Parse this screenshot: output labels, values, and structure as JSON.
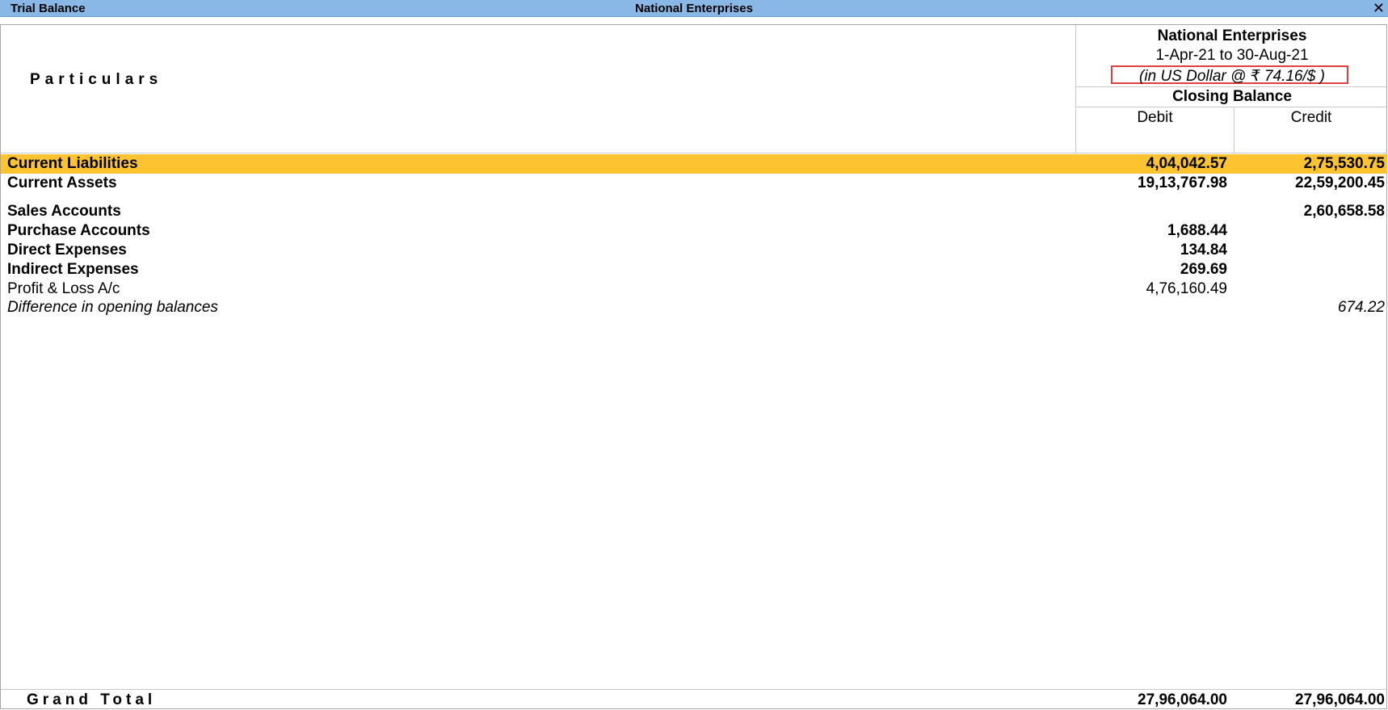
{
  "window": {
    "title": "Trial Balance",
    "company": "National Enterprises",
    "close_glyph": "✕"
  },
  "header": {
    "particulars_label": "Particulars",
    "company": "National Enterprises",
    "period": "1-Apr-21 to 30-Aug-21",
    "currency_note": "(in US Dollar  @ ₹ 74.16/$ )",
    "closing_balance_label": "Closing Balance",
    "debit_label": "Debit",
    "credit_label": "Credit"
  },
  "rows": [
    {
      "name": "Current Liabilities",
      "debit": "4,04,042.57",
      "credit": "2,75,530.75"
    },
    {
      "name": "Current Assets",
      "debit": "19,13,767.98",
      "credit": "22,59,200.45"
    },
    {
      "name": "Sales Accounts",
      "debit": "",
      "credit": "2,60,658.58"
    },
    {
      "name": "Purchase Accounts",
      "debit": "1,688.44",
      "credit": ""
    },
    {
      "name": "Direct Expenses",
      "debit": "134.84",
      "credit": ""
    },
    {
      "name": "Indirect Expenses",
      "debit": "269.69",
      "credit": ""
    },
    {
      "name": "Profit & Loss A/c",
      "debit": "4,76,160.49",
      "credit": ""
    },
    {
      "name": "Difference in opening balances",
      "debit": "",
      "credit": "674.22"
    }
  ],
  "grand_total": {
    "label": "Grand Total",
    "debit": "27,96,064.00",
    "credit": "27,96,064.00"
  },
  "colors": {
    "titlebar": "#8ab8e6",
    "highlight": "#fdc331",
    "currency_box_border": "#e04040"
  },
  "selected_row": "Current Liabilities"
}
